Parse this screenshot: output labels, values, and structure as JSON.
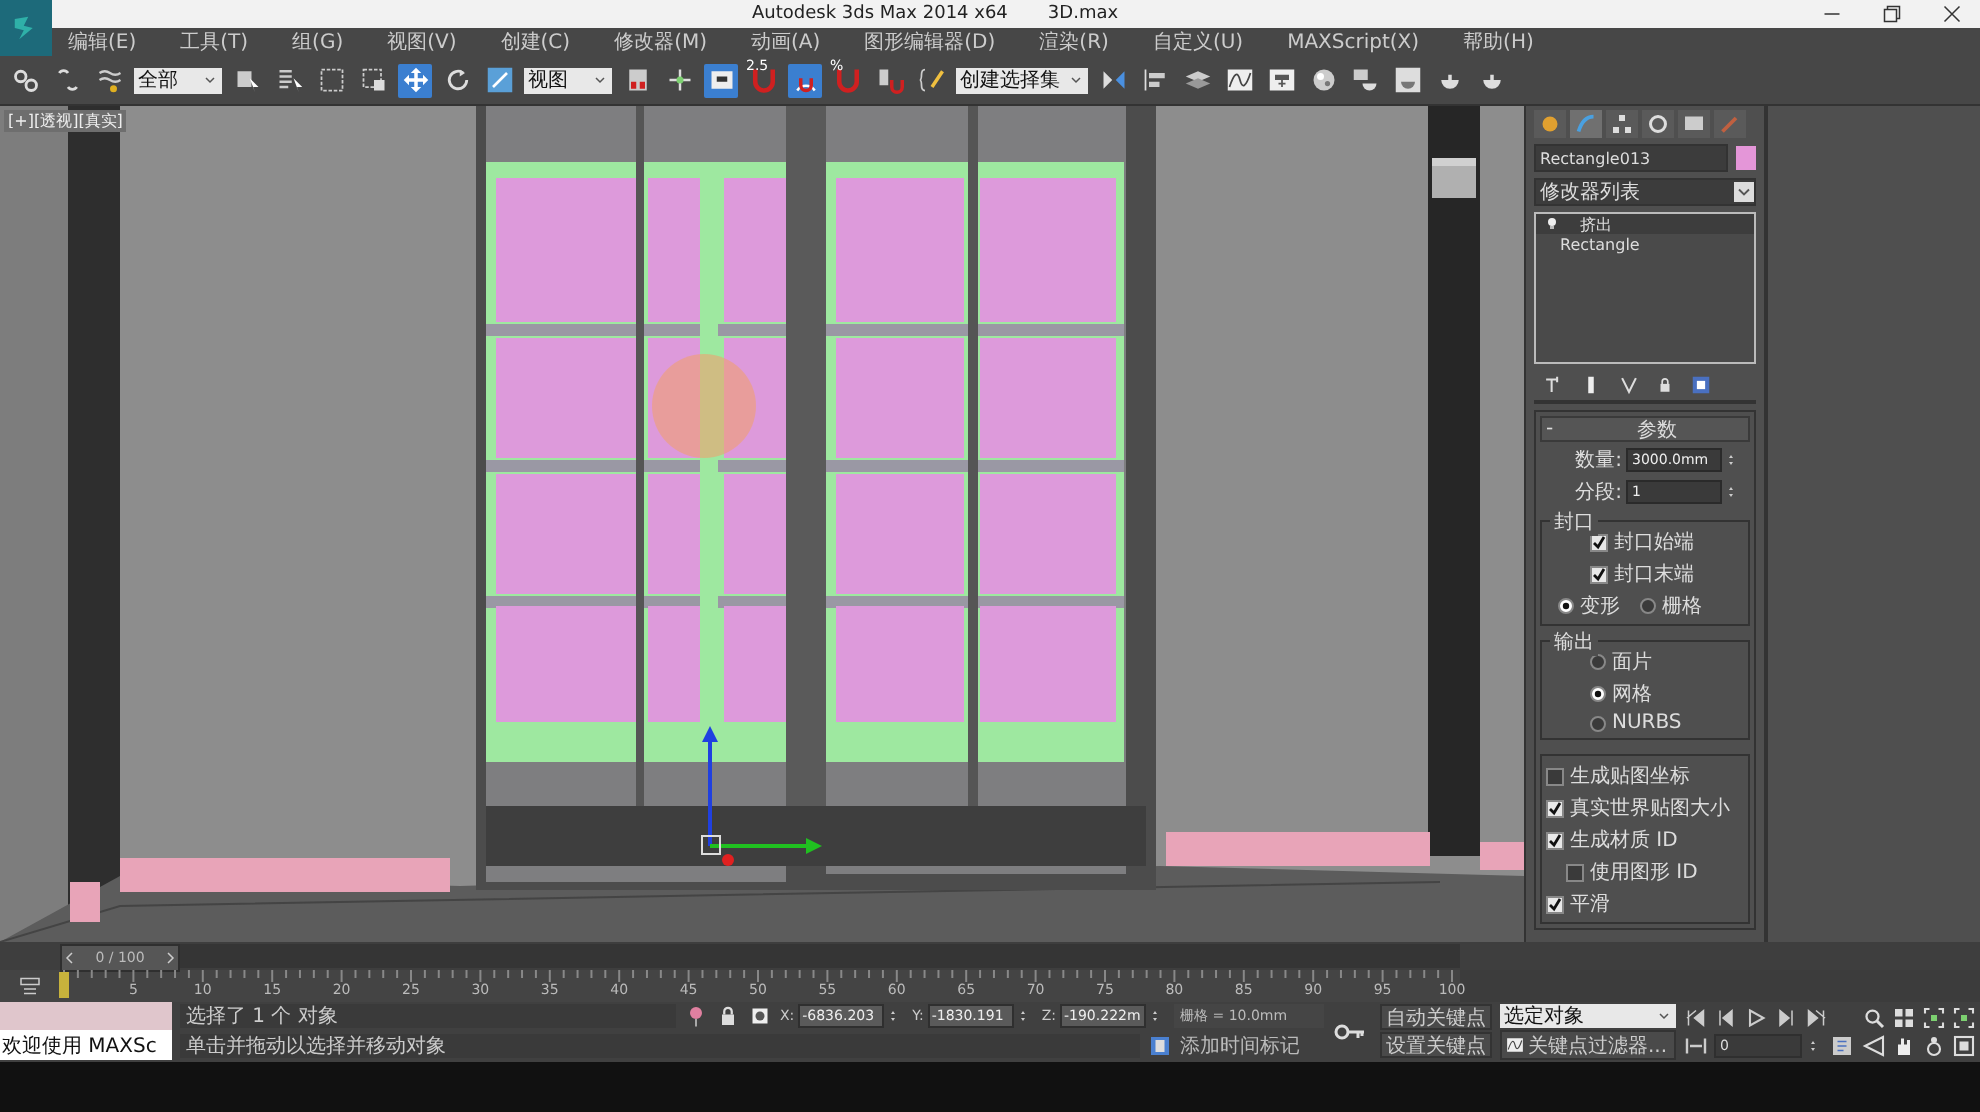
{
  "window": {
    "title": "Autodesk 3ds Max  2014 x64",
    "file": "3D.max"
  },
  "menu": [
    "编辑(E)",
    "工具(T)",
    "组(G)",
    "视图(V)",
    "创建(C)",
    "修改器(M)",
    "动画(A)",
    "图形编辑器(D)",
    "渲染(R)",
    "自定义(U)",
    "MAXScript(X)",
    "帮助(H)"
  ],
  "toolbar": [
    {
      "kind": "icon",
      "selected": false
    },
    {
      "kind": "icon",
      "selected": false
    },
    {
      "kind": "icon",
      "selected": false
    },
    {
      "kind": "dropdown",
      "value": "全部"
    },
    {
      "kind": "icon",
      "selected": false
    },
    {
      "kind": "icon",
      "selected": false
    },
    {
      "kind": "icon",
      "selected": false
    },
    {
      "kind": "icon",
      "selected": false
    },
    {
      "kind": "icon",
      "selected": true
    },
    {
      "kind": "icon",
      "selected": false
    },
    {
      "kind": "icon",
      "selected": false
    },
    {
      "kind": "dropdown",
      "value": "视图"
    },
    {
      "kind": "icon",
      "selected": false
    },
    {
      "kind": "icon",
      "selected": false
    },
    {
      "kind": "icon",
      "selected": true
    },
    {
      "kind": "icon",
      "selected": false,
      "label": "2.5"
    },
    {
      "kind": "icon",
      "selected": true
    },
    {
      "kind": "icon",
      "selected": false,
      "label": "%"
    },
    {
      "kind": "icon",
      "selected": false
    },
    {
      "kind": "icon",
      "selected": false
    },
    {
      "kind": "dropdown",
      "value": "创建选择集"
    },
    {
      "kind": "icon",
      "selected": false
    },
    {
      "kind": "icon",
      "selected": false
    },
    {
      "kind": "icon",
      "selected": false
    },
    {
      "kind": "icon",
      "selected": false
    },
    {
      "kind": "icon",
      "selected": false
    },
    {
      "kind": "icon",
      "selected": false
    },
    {
      "kind": "icon",
      "selected": false
    },
    {
      "kind": "icon",
      "selected": false
    },
    {
      "kind": "icon",
      "selected": false
    },
    {
      "kind": "icon",
      "selected": false
    }
  ],
  "viewport": {
    "label": "[+][透视][真实]"
  },
  "command_panel": {
    "tabs": [
      {
        "selected": false
      },
      {
        "selected": true
      },
      {
        "selected": false
      },
      {
        "selected": false
      },
      {
        "selected": false
      },
      {
        "selected": false
      }
    ],
    "object": {
      "name": "Rectangle013",
      "color": "#e496d8"
    },
    "modifier_list": "修改器列表",
    "stack": [
      {
        "kind": "modifier",
        "label": "挤出",
        "selected": true
      },
      {
        "kind": "base",
        "label": "Rectangle",
        "selected": false
      }
    ],
    "rollout": {
      "title": "参数",
      "collapse": "-",
      "fields": [
        {
          "label": "数量:",
          "value": "3000.0mm"
        },
        {
          "label": "分段:",
          "value": "1"
        }
      ],
      "groups": [
        {
          "title": "封口",
          "items": [
            {
              "kind": "checkbox",
              "label": "封口始端",
              "checked": true
            },
            {
              "kind": "checkbox",
              "label": "封口末端",
              "checked": true
            },
            {
              "kind": "radio-pair",
              "options": [
                {
                  "label": "变形",
                  "selected": true
                },
                {
                  "label": "栅格",
                  "selected": false
                }
              ]
            }
          ]
        },
        {
          "title": "输出",
          "items": [
            {
              "kind": "radio",
              "label": "面片",
              "selected": false
            },
            {
              "kind": "radio",
              "label": "网格",
              "selected": true
            },
            {
              "kind": "radio",
              "label": "NURBS",
              "selected": false
            }
          ]
        }
      ],
      "options": [
        {
          "label": "生成贴图坐标",
          "checked": false
        },
        {
          "label": "真实世界贴图大小",
          "checked": true
        },
        {
          "label": "生成材质 ID",
          "checked": true,
          "children": [
            {
              "label": "使用图形 ID",
              "checked": false
            }
          ]
        },
        {
          "label": "平滑",
          "checked": true
        }
      ]
    }
  },
  "time_slider": {
    "label": "0 / 100",
    "level": 0,
    "ticks": [
      "5",
      "10",
      "15",
      "20",
      "25",
      "30",
      "35",
      "40",
      "45",
      "50",
      "55",
      "60",
      "65",
      "70",
      "75",
      "80",
      "85",
      "90",
      "95",
      "100"
    ]
  },
  "status": {
    "listener": "欢迎使用 MAXSc",
    "selection": "选择了 1 个 对象",
    "prompt": "单击并拖动以选择并移动对象",
    "coords": [
      {
        "label": "X:",
        "value": "-6836.203"
      },
      {
        "label": "Y:",
        "value": "-1830.191"
      },
      {
        "label": "Z:",
        "value": "-190.222m"
      }
    ],
    "grid": "栅格 = 10.0mm",
    "time_tag": "添加时间标记",
    "auto_key": "自动关键点",
    "set_key": "设置关键点",
    "key_mode": "选定对象",
    "key_filters": "关键点过滤器...",
    "frame": "0"
  }
}
